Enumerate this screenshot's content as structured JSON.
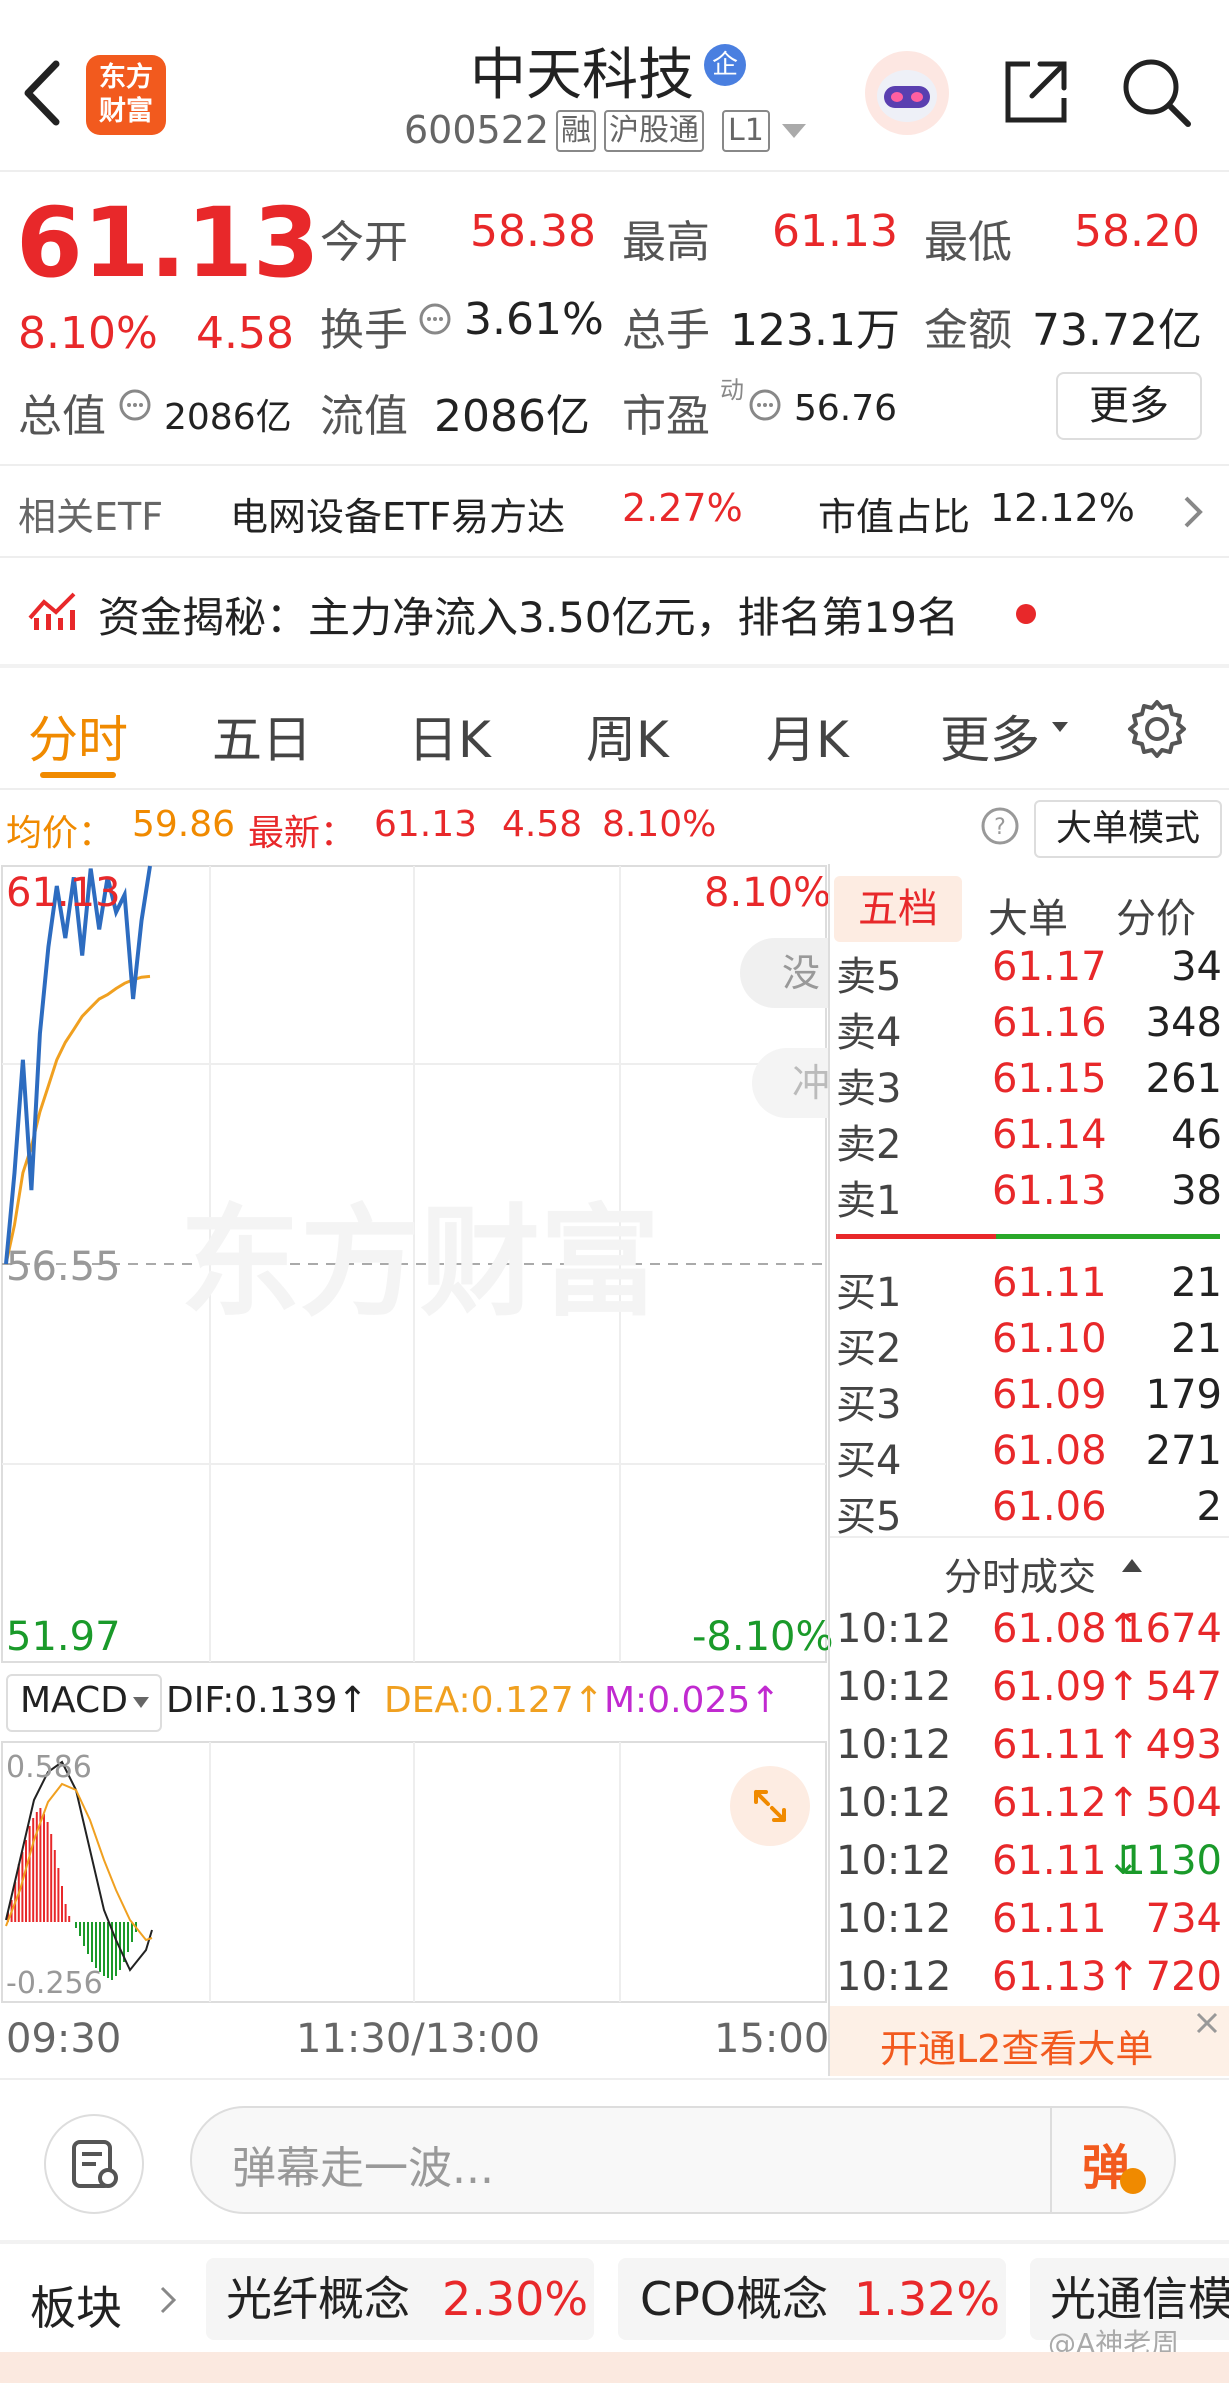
{
  "header": {
    "logo_text_1": "东方",
    "logo_text_2": "财富",
    "stock_name": "中天科技",
    "badge": "企",
    "code": "600522",
    "tags": [
      "融",
      "沪股通",
      "L1"
    ]
  },
  "quote": {
    "price": "61.13",
    "change_pct": "8.10%",
    "change": "4.58",
    "open_label": "今开",
    "open": "58.38",
    "high_label": "最高",
    "high": "61.13",
    "low_label": "最低",
    "low": "58.20",
    "turnover_label": "换手",
    "turnover": "3.61%",
    "volume_label": "总手",
    "volume": "123.1万",
    "amount_label": "金额",
    "amount": "73.72亿",
    "total_cap_label": "总值",
    "total_cap": "2086亿",
    "float_cap_label": "流值",
    "float_cap": "2086亿",
    "pe_label": "市盈",
    "pe_sup": "动",
    "pe": "56.76",
    "more_label": "更多"
  },
  "etf": {
    "label": "相关ETF",
    "name": "电网设备ETF易方达",
    "pct": "2.27%",
    "ratio_label": "市值占比",
    "ratio": "12.12%"
  },
  "funds": {
    "text": "资金揭秘：主力净流入3.50亿元，排名第19名"
  },
  "tabs": [
    "分时",
    "五日",
    "日K",
    "周K",
    "月K",
    "更多"
  ],
  "chart_info": {
    "avg_label": "均价：",
    "avg": "59.86",
    "last_label": "最新：",
    "last": "61.13",
    "chg": "4.58",
    "pct": "8.10%",
    "mode_button": "大单模式"
  },
  "chart": {
    "top_price": "61.13",
    "top_pct": "8.10%",
    "mid_price": "56.55",
    "bottom_price": "51.97",
    "bottom_pct": "-8.10%",
    "side_tab_1": "没",
    "side_tab_2": "冲",
    "watermark": "东方财富",
    "time_start": "09:30",
    "time_mid": "11:30/13:00",
    "time_end": "15:00"
  },
  "chart_data": {
    "type": "line",
    "series": [
      {
        "values": [
          56.55,
          57.6,
          58.9,
          57.4,
          59.2,
          60.2,
          60.9,
          60.3,
          61.0,
          60.1,
          61.1,
          60.4,
          61.0,
          60.6,
          60.8,
          59.6,
          60.5,
          61.13
        ]
      },
      {
        "values": [
          56.55,
          57.0,
          57.6,
          57.9,
          58.3,
          58.6,
          58.9,
          59.1,
          59.25,
          59.4,
          59.5,
          59.6,
          59.65,
          59.72,
          59.78,
          59.82,
          59.85,
          59.86
        ]
      }
    ],
    "ylim": [
      51.97,
      61.13
    ]
  },
  "macd": {
    "label": "MACD",
    "dif": "DIF:0.139↑",
    "dea": "DEA:0.127↑",
    "m": "M:0.025↑",
    "top": "0.586",
    "bottom": "-0.256"
  },
  "orderbook": {
    "tabs": [
      "五档",
      "大单",
      "分价"
    ],
    "sells": [
      {
        "label": "卖5",
        "price": "61.17",
        "vol": "34"
      },
      {
        "label": "卖4",
        "price": "61.16",
        "vol": "348"
      },
      {
        "label": "卖3",
        "price": "61.15",
        "vol": "261"
      },
      {
        "label": "卖2",
        "price": "61.14",
        "vol": "46"
      },
      {
        "label": "卖1",
        "price": "61.13",
        "vol": "38"
      }
    ],
    "buys": [
      {
        "label": "买1",
        "price": "61.11",
        "vol": "21"
      },
      {
        "label": "买2",
        "price": "61.10",
        "vol": "21"
      },
      {
        "label": "买3",
        "price": "61.09",
        "vol": "179"
      },
      {
        "label": "买4",
        "price": "61.08",
        "vol": "271"
      },
      {
        "label": "买5",
        "price": "61.06",
        "vol": "2"
      }
    ],
    "trades_title": "分时成交",
    "trades": [
      {
        "time": "10:12",
        "price": "61.08",
        "arrow": "↑",
        "vol": "1674",
        "dir": "up"
      },
      {
        "time": "10:12",
        "price": "61.09",
        "arrow": "↑",
        "vol": "547",
        "dir": "up"
      },
      {
        "time": "10:12",
        "price": "61.11",
        "arrow": "↑",
        "vol": "493",
        "dir": "up"
      },
      {
        "time": "10:12",
        "price": "61.12",
        "arrow": "↑",
        "vol": "504",
        "dir": "up"
      },
      {
        "time": "10:12",
        "price": "61.11",
        "arrow": "↓",
        "vol": "1130",
        "dir": "down"
      },
      {
        "time": "10:12",
        "price": "61.11",
        "arrow": "",
        "vol": "734",
        "dir": "up"
      },
      {
        "time": "10:12",
        "price": "61.13",
        "arrow": "↑",
        "vol": "720",
        "dir": "up"
      }
    ],
    "l2_banner": "开通L2查看大单"
  },
  "danmu": {
    "placeholder": "弹幕走一波...",
    "button": "弹"
  },
  "sectors": {
    "label": "板块",
    "items": [
      {
        "name": "光纤概念",
        "pct": "2.30%"
      },
      {
        "name": "CPO概念",
        "pct": "1.32%"
      },
      {
        "name": "光通信模",
        "pct": ""
      }
    ],
    "watermark": "@A神老周"
  },
  "colors": {
    "up": "#e8282a",
    "down": "#1a9a2a",
    "accent": "#f08a00",
    "price_line": "#2d6cc0",
    "avg_line": "#f0a020"
  }
}
